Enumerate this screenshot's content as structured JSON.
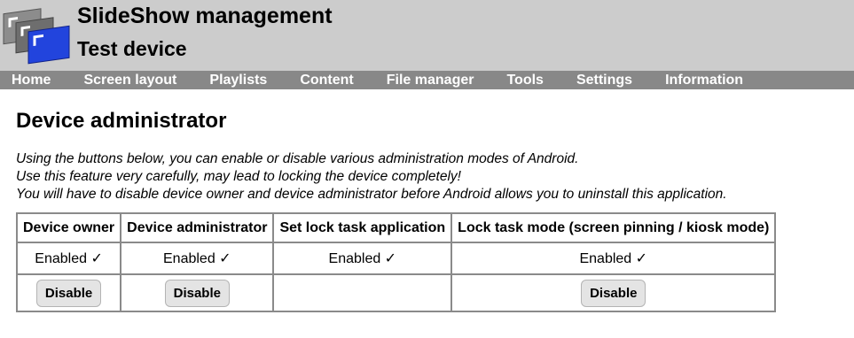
{
  "header": {
    "app_title": "SlideShow management",
    "device_name": "Test device"
  },
  "nav": {
    "items": [
      "Home",
      "Screen layout",
      "Playlists",
      "Content",
      "File manager",
      "Tools",
      "Settings",
      "Information"
    ]
  },
  "page": {
    "title": "Device administrator",
    "description": [
      "Using the buttons below, you can enable or disable various administration modes of Android.",
      "Use this feature very carefully, may lead to locking the device completely!",
      "You will have to disable device owner and device administrator before Android allows you to uninstall this application."
    ]
  },
  "table": {
    "headers": [
      "Device owner",
      "Device administrator",
      "Set lock task application",
      "Lock task mode (screen pinning / kiosk mode)"
    ],
    "status": [
      "Enabled ✓",
      "Enabled ✓",
      "Enabled ✓",
      "Enabled ✓"
    ],
    "buttons": [
      "Disable",
      "Disable",
      "",
      "Disable"
    ]
  },
  "colors": {
    "header_bg": "#cccccc",
    "nav_bg": "#888888",
    "logo_front": "#2244dd",
    "logo_back": "#777777"
  }
}
